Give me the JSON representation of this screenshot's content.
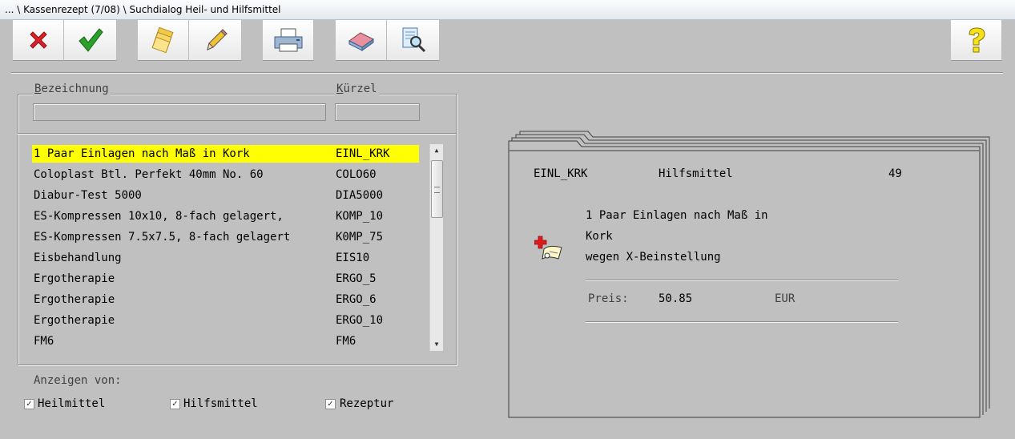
{
  "window": {
    "title": "... \\ Kassenrezept (7/08) \\ Suchdialog Heil- und Hilfsmittel"
  },
  "toolbar": {
    "buttons": [
      {
        "name": "cancel",
        "icon": "red-x-icon"
      },
      {
        "name": "ok",
        "icon": "green-checkmark-icon"
      },
      {
        "name": "new",
        "icon": "stacked-cards-icon"
      },
      {
        "name": "edit",
        "icon": "pencil-icon"
      },
      {
        "name": "print",
        "icon": "printer-icon"
      },
      {
        "name": "erase",
        "icon": "eraser-icon"
      },
      {
        "name": "search-doc",
        "icon": "magnifier-document-icon"
      },
      {
        "name": "help",
        "icon": "question-mark-icon"
      }
    ]
  },
  "search": {
    "bezeichnung_label_first": "B",
    "bezeichnung_label_rest": "ezeichnung",
    "kuerzel_label_first": "K",
    "kuerzel_label_rest": "ürzel",
    "bezeichnung_value": "",
    "kuerzel_value": ""
  },
  "list": {
    "items": [
      {
        "name": "1 Paar Einlagen nach Maß in Kork",
        "kuerzel": "EINL_KRK",
        "selected": true
      },
      {
        "name": "Coloplast Btl. Perfekt 40mm No. 60",
        "kuerzel": "COLO60"
      },
      {
        "name": "Diabur-Test 5000",
        "kuerzel": "DIA5000"
      },
      {
        "name": "ES-Kompressen 10x10, 8-fach gelagert,",
        "kuerzel": "KOMP_10"
      },
      {
        "name": "ES-Kompressen 7.5x7.5, 8-fach gelagert",
        "kuerzel": "K0MP_75"
      },
      {
        "name": "Eisbehandlung",
        "kuerzel": "EIS10"
      },
      {
        "name": "Ergotherapie",
        "kuerzel": "ERGO_5"
      },
      {
        "name": "Ergotherapie",
        "kuerzel": "ERGO_6"
      },
      {
        "name": "Ergotherapie",
        "kuerzel": "ERGO_10"
      },
      {
        "name": "FM6",
        "kuerzel": "FM6"
      }
    ]
  },
  "filter": {
    "label": "Anzeigen von:",
    "options": [
      {
        "label": "Heilmittel",
        "checked": true
      },
      {
        "label": "Hilfsmittel",
        "checked": true
      },
      {
        "label": "Rezeptur",
        "checked": true
      }
    ],
    "check_glyph": "✓"
  },
  "detail": {
    "kuerzel": "EINL_KRK",
    "type": "Hilfsmittel",
    "number": "49",
    "desc_line1": "1 Paar Einlagen nach Maß in",
    "desc_line2": "Kork",
    "desc_line3": "wegen X-Beinstellung",
    "price_label": "Preis:",
    "price_value": "50.85",
    "currency": "EUR",
    "icon": "red-cross-document-icon"
  }
}
